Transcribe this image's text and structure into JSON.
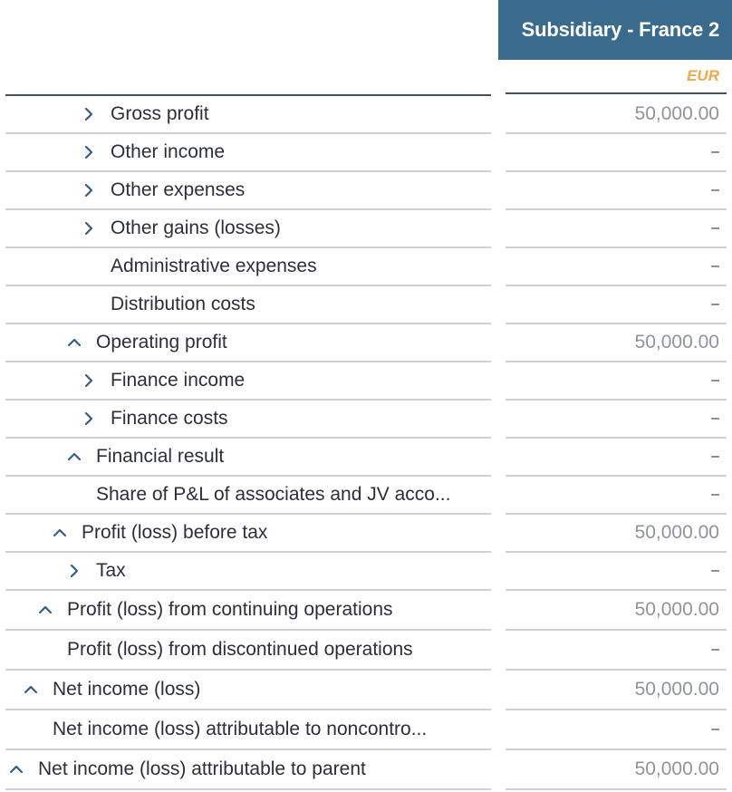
{
  "header": {
    "column_title": "Subsidiary - France 2",
    "currency": "EUR"
  },
  "colors": {
    "header_bg": "#3a6b8c",
    "currency": "#f0a84e",
    "icon": "#3a5a85"
  },
  "rows": [
    {
      "label": "Gross profit",
      "icon": "chevron-right",
      "indent": 4,
      "value": "50,000.00"
    },
    {
      "label": "Other income",
      "icon": "chevron-right",
      "indent": 4,
      "value": "–"
    },
    {
      "label": "Other expenses",
      "icon": "chevron-right",
      "indent": 4,
      "value": "–"
    },
    {
      "label": "Other gains (losses)",
      "icon": "chevron-right",
      "indent": 4,
      "value": "–"
    },
    {
      "label": "Administrative expenses",
      "icon": "none",
      "indent": 4,
      "value": "–"
    },
    {
      "label": "Distribution costs",
      "icon": "none",
      "indent": 4,
      "value": "–"
    },
    {
      "label": "Operating profit",
      "icon": "chevron-up",
      "indent": 3,
      "value": "50,000.00"
    },
    {
      "label": "Finance income",
      "icon": "chevron-right",
      "indent": 4,
      "value": "–"
    },
    {
      "label": "Finance costs",
      "icon": "chevron-right",
      "indent": 4,
      "value": "–"
    },
    {
      "label": "Financial result",
      "icon": "chevron-up",
      "indent": 3,
      "value": "–"
    },
    {
      "label": "Share of P&L of associates and JV acco...",
      "icon": "none",
      "indent": 3,
      "value": "–"
    },
    {
      "label": "Profit (loss) before tax",
      "icon": "chevron-up",
      "indent": 2,
      "value": "50,000.00"
    },
    {
      "label": "Tax",
      "icon": "chevron-right",
      "indent": 3,
      "value": "–"
    },
    {
      "label": "Profit (loss) from continuing operations",
      "icon": "chevron-up",
      "indent": 1,
      "value": "50,000.00"
    },
    {
      "label": "Profit (loss) from discontinued operations",
      "icon": "none",
      "indent": 1,
      "value": "–"
    },
    {
      "label": "Net income (loss)",
      "icon": "chevron-up",
      "indent": 0,
      "value": "50,000.00"
    },
    {
      "label": "Net income (loss) attributable to noncontro...",
      "icon": "none",
      "indent": 0,
      "value": "–"
    },
    {
      "label": "Net income (loss) attributable to parent",
      "icon": "chevron-up",
      "indent": -1,
      "value": "50,000.00"
    }
  ]
}
